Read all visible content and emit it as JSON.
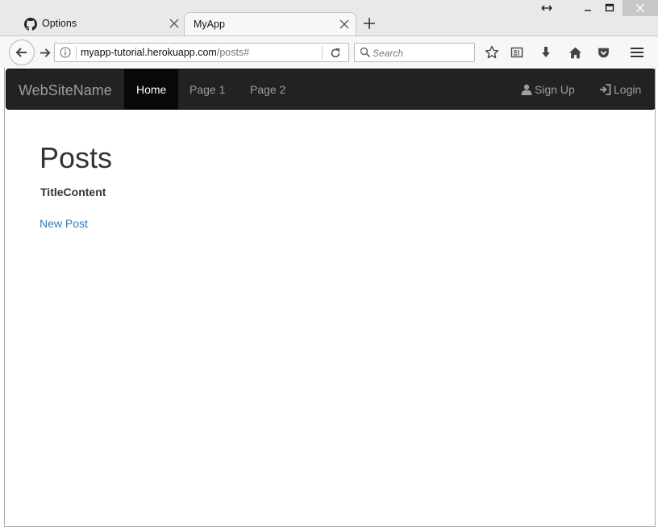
{
  "browser": {
    "tabs": [
      {
        "label": "Options",
        "icon": "github-icon",
        "active": false
      },
      {
        "label": "MyApp",
        "icon": "",
        "active": true
      }
    ],
    "url": {
      "host": "myapp-tutorial.herokuapp.com",
      "path": "/posts#"
    },
    "search": {
      "placeholder": "Search"
    }
  },
  "navbar": {
    "brand": "WebSiteName",
    "items": [
      {
        "label": "Home",
        "active": true
      },
      {
        "label": "Page 1",
        "active": false
      },
      {
        "label": "Page 2",
        "active": false
      }
    ],
    "right_items": [
      {
        "label": "Sign Up",
        "icon": "user-icon"
      },
      {
        "label": "Login",
        "icon": "login-icon"
      }
    ]
  },
  "main": {
    "heading": "Posts",
    "table_headers": [
      "Title",
      "Content"
    ],
    "new_post_link": "New Post"
  },
  "colors": {
    "navbar_bg": "#222222",
    "navbar_active": "#080808",
    "link": "#337ab7"
  }
}
